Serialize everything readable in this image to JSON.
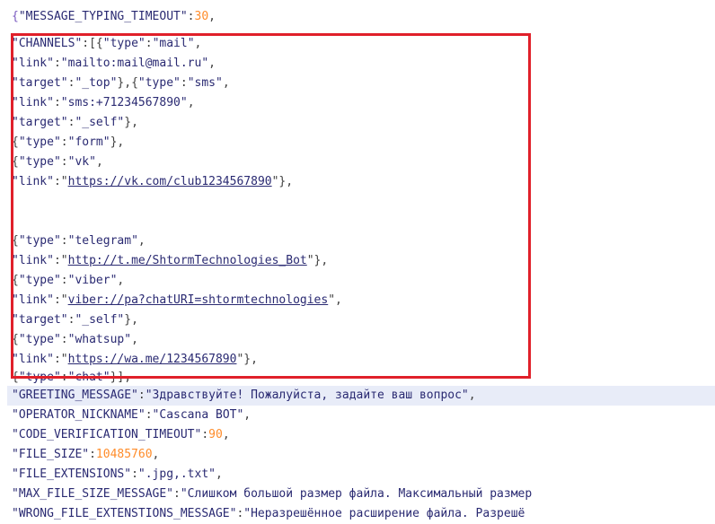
{
  "lines": [
    {
      "id": "l1",
      "parts": [
        {
          "t": "{",
          "c": "brace"
        },
        {
          "t": "\"MESSAGE_TYPING_TIMEOUT\"",
          "c": "s"
        },
        {
          "t": ":",
          "c": "p"
        },
        {
          "t": "30",
          "c": "n"
        },
        {
          "t": ",",
          "c": "p"
        }
      ]
    },
    {
      "id": "l2",
      "parts": [
        {
          "t": "\"CHANNELS\"",
          "c": "s"
        },
        {
          "t": ":[{",
          "c": "p"
        },
        {
          "t": "\"type\"",
          "c": "s"
        },
        {
          "t": ":",
          "c": "p"
        },
        {
          "t": "\"mail\"",
          "c": "s"
        },
        {
          "t": ",",
          "c": "p"
        }
      ]
    },
    {
      "id": "l3",
      "parts": [
        {
          "t": "\"link\"",
          "c": "s"
        },
        {
          "t": ":",
          "c": "p"
        },
        {
          "t": "\"mailto:mail@mail.ru\"",
          "c": "s"
        },
        {
          "t": ",",
          "c": "p"
        }
      ]
    },
    {
      "id": "l4",
      "parts": [
        {
          "t": "\"target\"",
          "c": "s"
        },
        {
          "t": ":",
          "c": "p"
        },
        {
          "t": "\"_top\"",
          "c": "s"
        },
        {
          "t": "},{",
          "c": "p"
        },
        {
          "t": "\"type\"",
          "c": "s"
        },
        {
          "t": ":",
          "c": "p"
        },
        {
          "t": "\"sms\"",
          "c": "s"
        },
        {
          "t": ",",
          "c": "p"
        }
      ]
    },
    {
      "id": "l5",
      "parts": [
        {
          "t": "\"link\"",
          "c": "s"
        },
        {
          "t": ":",
          "c": "p"
        },
        {
          "t": "\"sms:+71234567890\"",
          "c": "s"
        },
        {
          "t": ",",
          "c": "p"
        }
      ]
    },
    {
      "id": "l6",
      "parts": [
        {
          "t": "\"target\"",
          "c": "s"
        },
        {
          "t": ":",
          "c": "p"
        },
        {
          "t": "\"_self\"",
          "c": "s"
        },
        {
          "t": "},",
          "c": "p"
        }
      ]
    },
    {
      "id": "l7",
      "parts": [
        {
          "t": "{",
          "c": "p"
        },
        {
          "t": "\"type\"",
          "c": "s"
        },
        {
          "t": ":",
          "c": "p"
        },
        {
          "t": "\"form\"",
          "c": "s"
        },
        {
          "t": "},",
          "c": "p"
        }
      ]
    },
    {
      "id": "l8",
      "parts": [
        {
          "t": "{",
          "c": "p"
        },
        {
          "t": "\"type\"",
          "c": "s"
        },
        {
          "t": ":",
          "c": "p"
        },
        {
          "t": "\"vk\"",
          "c": "s"
        },
        {
          "t": ",",
          "c": "p"
        }
      ]
    },
    {
      "id": "l9",
      "parts": [
        {
          "t": "\"link\"",
          "c": "s"
        },
        {
          "t": ":\"",
          "c": "p"
        },
        {
          "t": "https://vk.com/club1234567890",
          "c": "u"
        },
        {
          "t": "\"},",
          "c": "p"
        }
      ]
    },
    {
      "id": "l10",
      "parts": []
    },
    {
      "id": "l11",
      "parts": []
    },
    {
      "id": "l12",
      "parts": [
        {
          "t": "{",
          "c": "p"
        },
        {
          "t": "\"type\"",
          "c": "s"
        },
        {
          "t": ":",
          "c": "p"
        },
        {
          "t": "\"telegram\"",
          "c": "s"
        },
        {
          "t": ",",
          "c": "p"
        }
      ]
    },
    {
      "id": "l13",
      "parts": [
        {
          "t": "\"link\"",
          "c": "s"
        },
        {
          "t": ":\"",
          "c": "p"
        },
        {
          "t": "http://t.me/ShtormTechnologies_Bot",
          "c": "u"
        },
        {
          "t": "\"},",
          "c": "p"
        }
      ]
    },
    {
      "id": "l14",
      "parts": [
        {
          "t": "{",
          "c": "p"
        },
        {
          "t": "\"type\"",
          "c": "s"
        },
        {
          "t": ":",
          "c": "p"
        },
        {
          "t": "\"viber\"",
          "c": "s"
        },
        {
          "t": ",",
          "c": "p"
        }
      ]
    },
    {
      "id": "l15",
      "parts": [
        {
          "t": "\"link\"",
          "c": "s"
        },
        {
          "t": ":\"",
          "c": "p"
        },
        {
          "t": "viber://pa?chatURI=shtormtechnologies",
          "c": "u"
        },
        {
          "t": "\",",
          "c": "p"
        }
      ]
    },
    {
      "id": "l16",
      "parts": [
        {
          "t": "\"target\"",
          "c": "s"
        },
        {
          "t": ":",
          "c": "p"
        },
        {
          "t": "\"_self\"",
          "c": "s"
        },
        {
          "t": "},",
          "c": "p"
        }
      ]
    },
    {
      "id": "l17",
      "parts": [
        {
          "t": "{",
          "c": "p"
        },
        {
          "t": "\"type\"",
          "c": "s"
        },
        {
          "t": ":",
          "c": "p"
        },
        {
          "t": "\"whatsup\"",
          "c": "s"
        },
        {
          "t": ",",
          "c": "p"
        }
      ]
    },
    {
      "id": "l18",
      "parts": [
        {
          "t": "\"link\"",
          "c": "s"
        },
        {
          "t": ":\"",
          "c": "p"
        },
        {
          "t": "https://wa.me/1234567890",
          "c": "u"
        },
        {
          "t": "\"},",
          "c": "p"
        }
      ]
    },
    {
      "id": "l19",
      "parts": [
        {
          "t": "{",
          "c": "p"
        },
        {
          "t": "\"type\"",
          "c": "s"
        },
        {
          "t": ":",
          "c": "p"
        },
        {
          "t": "\"chat\"",
          "c": "s"
        },
        {
          "t": "}],",
          "c": "p"
        }
      ]
    },
    {
      "id": "l20",
      "parts": [
        {
          "t": "\"GREETING_MESSAGE\"",
          "c": "s"
        },
        {
          "t": ":",
          "c": "p"
        },
        {
          "t": "\"Здравствуйте! Пожалуйста, задайте ваш вопрос\"",
          "c": "s"
        },
        {
          "t": ",",
          "c": "p"
        }
      ]
    },
    {
      "id": "l21",
      "parts": [
        {
          "t": "\"OPERATOR_NICKNAME\"",
          "c": "s"
        },
        {
          "t": ":",
          "c": "p"
        },
        {
          "t": "\"Cascana BOT\"",
          "c": "s"
        },
        {
          "t": ",",
          "c": "p"
        }
      ]
    },
    {
      "id": "l22",
      "parts": [
        {
          "t": "\"CODE_VERIFICATION_TIMEOUT\"",
          "c": "s"
        },
        {
          "t": ":",
          "c": "p"
        },
        {
          "t": "90",
          "c": "n"
        },
        {
          "t": ",",
          "c": "p"
        }
      ]
    },
    {
      "id": "l23",
      "parts": [
        {
          "t": "\"FILE_SIZE\"",
          "c": "s"
        },
        {
          "t": ":",
          "c": "p"
        },
        {
          "t": "10485760",
          "c": "n"
        },
        {
          "t": ",",
          "c": "p"
        }
      ]
    },
    {
      "id": "l24",
      "parts": [
        {
          "t": "\"FILE_EXTENSIONS\"",
          "c": "s"
        },
        {
          "t": ":",
          "c": "p"
        },
        {
          "t": "\".jpg,.txt\"",
          "c": "s"
        },
        {
          "t": ",",
          "c": "p"
        }
      ]
    },
    {
      "id": "l25",
      "parts": [
        {
          "t": "\"MAX_FILE_SIZE_MESSAGE\"",
          "c": "s"
        },
        {
          "t": ":",
          "c": "p"
        },
        {
          "t": "\"Слишком большой размер файла. Максимальный размер",
          "c": "s"
        }
      ]
    },
    {
      "id": "l26",
      "parts": [
        {
          "t": "\"WRONG_FILE_EXTENSTIONS_MESSAGE\"",
          "c": "s"
        },
        {
          "t": ":",
          "c": "p"
        },
        {
          "t": "\"Неразрешённое расширение файла. Разрешё",
          "c": "s"
        }
      ]
    }
  ],
  "highlighted_line": "l20",
  "colors": {
    "selection_border": "#e0202a",
    "string": "#2a2a72",
    "number": "#ff8c2a",
    "highlight": "#e8ecf8"
  }
}
